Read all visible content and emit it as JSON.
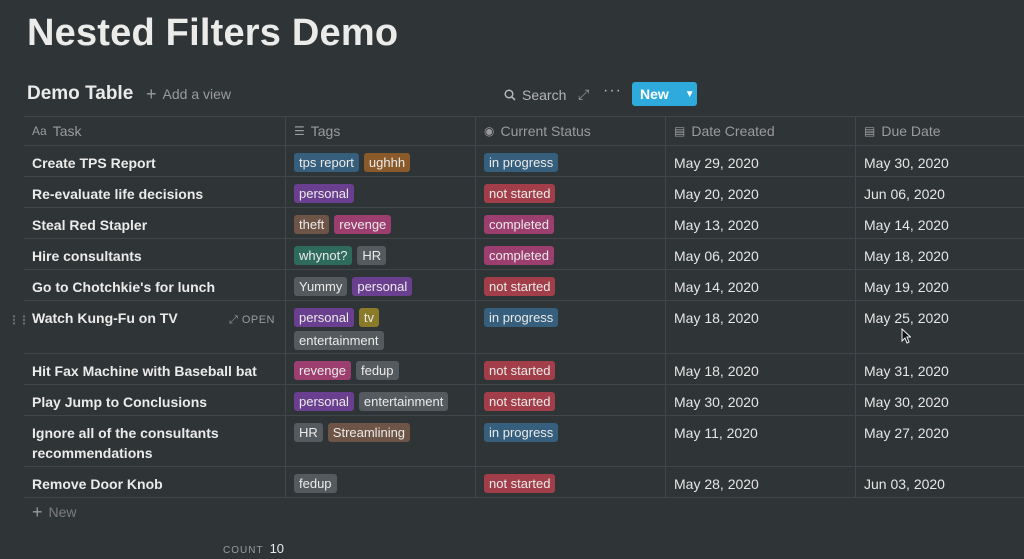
{
  "page": {
    "title": "Nested Filters Demo"
  },
  "view": {
    "db_title": "Demo Table",
    "add_view": "Add a view",
    "search": "Search",
    "new_label": "New"
  },
  "columns": {
    "task": "Task",
    "tags": "Tags",
    "status": "Current Status",
    "created": "Date Created",
    "due": "Due Date"
  },
  "colors": {
    "blue": "#365e7d",
    "orange": "#8a5a2a",
    "purple": "#6a3f8f",
    "red": "#a23e4a",
    "pink": "#9c3e6f",
    "brown": "#6e5446",
    "green": "#2e6b5d",
    "gray": "#555a5e",
    "yellow": "#8b7a28",
    "accent": "#2eaadc"
  },
  "rows": [
    {
      "task": "Create TPS Report",
      "tags": [
        {
          "t": "tps report",
          "c": "blue"
        },
        {
          "t": "ughhh",
          "c": "orange"
        }
      ],
      "status": {
        "t": "in progress",
        "c": "blue"
      },
      "created": "May 29, 2020",
      "due": "May 30, 2020"
    },
    {
      "task": "Re-evaluate life decisions",
      "tags": [
        {
          "t": "personal",
          "c": "purple"
        }
      ],
      "status": {
        "t": "not started",
        "c": "red"
      },
      "created": "May 20, 2020",
      "due": "Jun 06, 2020"
    },
    {
      "task": "Steal Red Stapler",
      "tags": [
        {
          "t": "theft",
          "c": "brown"
        },
        {
          "t": "revenge",
          "c": "pink"
        }
      ],
      "status": {
        "t": "completed",
        "c": "pink"
      },
      "created": "May 13, 2020",
      "due": "May 14, 2020"
    },
    {
      "task": "Hire consultants",
      "tags": [
        {
          "t": "whynot?",
          "c": "green"
        },
        {
          "t": "HR",
          "c": "gray"
        }
      ],
      "status": {
        "t": "completed",
        "c": "pink"
      },
      "created": "May 06, 2020",
      "due": "May 18, 2020"
    },
    {
      "task": "Go to Chotchkie's for lunch",
      "tags": [
        {
          "t": "Yummy",
          "c": "gray"
        },
        {
          "t": "personal",
          "c": "purple"
        }
      ],
      "status": {
        "t": "not started",
        "c": "red"
      },
      "created": "May 14, 2020",
      "due": "May 19, 2020"
    },
    {
      "task": "Watch Kung-Fu on TV",
      "open": "OPEN",
      "tags": [
        {
          "t": "personal",
          "c": "purple"
        },
        {
          "t": "tv",
          "c": "yellow"
        },
        {
          "t": "entertainment",
          "c": "gray"
        }
      ],
      "status": {
        "t": "in progress",
        "c": "blue"
      },
      "created": "May 18, 2020",
      "due": "May 25, 2020"
    },
    {
      "task": "Hit Fax Machine with Baseball bat",
      "tags": [
        {
          "t": "revenge",
          "c": "pink"
        },
        {
          "t": "fedup",
          "c": "gray"
        }
      ],
      "status": {
        "t": "not started",
        "c": "red"
      },
      "created": "May 18, 2020",
      "due": "May 31, 2020"
    },
    {
      "task": "Play Jump to Conclusions",
      "tags": [
        {
          "t": "personal",
          "c": "purple"
        },
        {
          "t": "entertainment",
          "c": "gray"
        }
      ],
      "status": {
        "t": "not started",
        "c": "red"
      },
      "created": "May 30, 2020",
      "due": "May 30, 2020"
    },
    {
      "task": "Ignore all of the consultants recommendations",
      "tags": [
        {
          "t": "HR",
          "c": "gray"
        },
        {
          "t": "Streamlining",
          "c": "brown"
        }
      ],
      "status": {
        "t": "in progress",
        "c": "blue"
      },
      "created": "May 11, 2020",
      "due": "May 27, 2020"
    },
    {
      "task": "Remove Door Knob",
      "tags": [
        {
          "t": "fedup",
          "c": "gray"
        }
      ],
      "status": {
        "t": "not started",
        "c": "red"
      },
      "created": "May 28, 2020",
      "due": "Jun 03, 2020"
    }
  ],
  "footer": {
    "new_label": "New",
    "count_label": "COUNT",
    "count_value": "10"
  }
}
